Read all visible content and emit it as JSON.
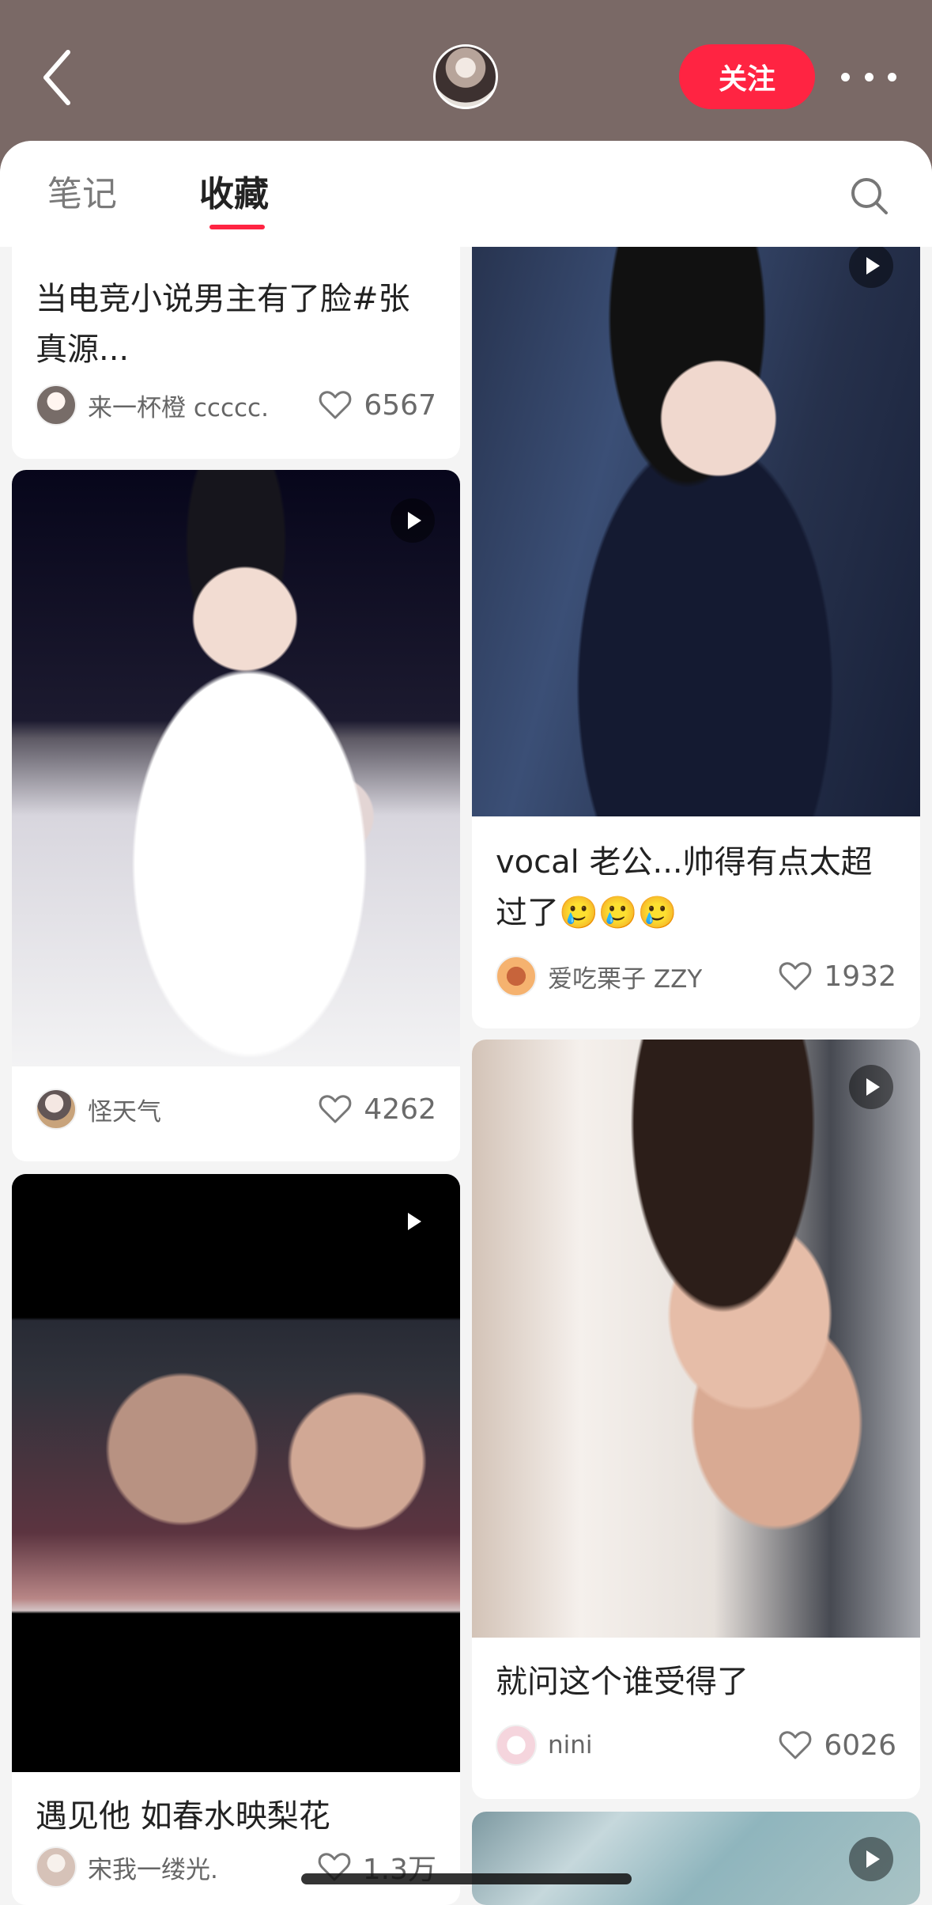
{
  "header": {
    "follow_label": "关注"
  },
  "tabs": [
    {
      "label": "笔记"
    },
    {
      "label": "收藏"
    }
  ],
  "cards": [
    {
      "title": "当电竞小说男主有了脸#张真源...",
      "author": "来一杯橙 ccccc.",
      "likes": "6567"
    },
    {
      "title": "",
      "author": "怪天气",
      "likes": "4262"
    },
    {
      "title": "vocal 老公...帅得有点太超过了🥲🥲🥲",
      "author": "爱吃栗子 ZZY",
      "likes": "1932"
    },
    {
      "title": "遇见他 如春水映梨花",
      "author": "宋我一缕光.",
      "likes": "1.3万"
    },
    {
      "title": "就问这个谁受得了",
      "author": "nini",
      "likes": "6026"
    }
  ],
  "colors": {
    "accent": "#ff2442",
    "header_bg": "#7a6966",
    "feed_bg": "#f4f4f4"
  }
}
